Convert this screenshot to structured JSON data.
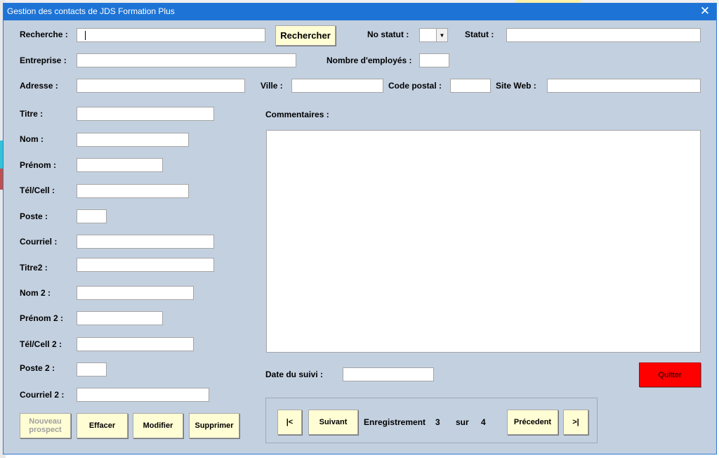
{
  "window": {
    "title": "Gestion des contacts de JDS Formation Plus"
  },
  "search": {
    "label": "Recherche :",
    "value": "",
    "button": "Rechercher"
  },
  "status": {
    "no_label": "No statut :",
    "no_value": "",
    "label": "Statut :",
    "value": ""
  },
  "company": {
    "label": "Entreprise :",
    "value": "",
    "employees_label": "Nombre d'employés :",
    "employees_value": ""
  },
  "address": {
    "label": "Adresse :",
    "value": "",
    "city_label": "Ville :",
    "city_value": "",
    "postal_label": "Code postal :",
    "postal_value": "",
    "website_label": "Site Web :",
    "website_value": ""
  },
  "contact": {
    "titre_label": "Titre :",
    "nom_label": "Nom :",
    "prenom_label": "Prénom :",
    "tel_label": "Tél/Cell :",
    "poste_label": "Poste :",
    "courriel_label": "Courriel :",
    "titre2_label": "Titre2 :",
    "nom2_label": "Nom 2 :",
    "prenom2_label": "Prénom 2 :",
    "tel2_label": "Tél/Cell 2 :",
    "poste2_label": "Poste 2 :",
    "courriel2_label": "Courriel 2 :"
  },
  "comments": {
    "label": "Commentaires :",
    "value": ""
  },
  "followup": {
    "label": "Date du suivi :",
    "value": ""
  },
  "actions": {
    "new_line1": "Nouveau",
    "new_line2": "prospect",
    "clear": "Effacer",
    "modify": "Modifier",
    "delete": "Supprimer",
    "quit": "Quitter"
  },
  "navigation": {
    "first": "|<",
    "next": "Suivant",
    "record_label": "Enregistrement",
    "current": "3",
    "of": "sur",
    "total": "4",
    "previous": "Précedent",
    "last": ">|"
  },
  "colors": {
    "window_bg": "#c3d0e0",
    "titlebar": "#1e74d6",
    "button_bg": "#fffdd4",
    "quit_bg": "#ff0000"
  }
}
